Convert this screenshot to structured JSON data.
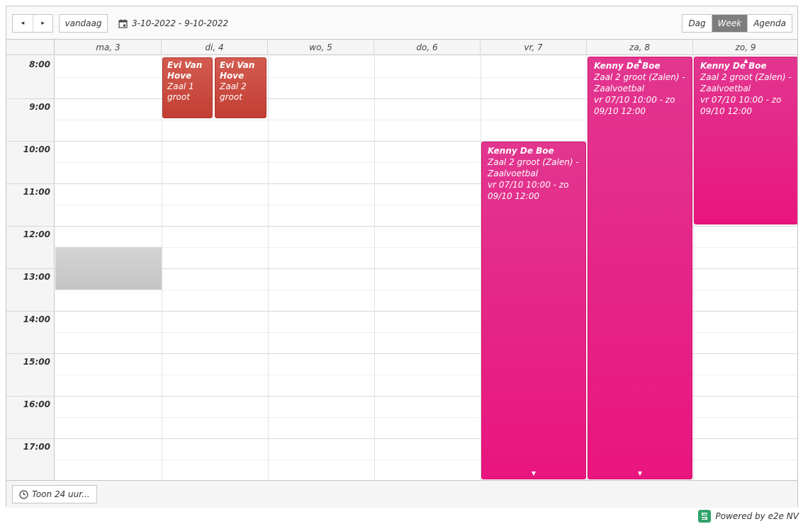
{
  "toolbar": {
    "prev_icon": "◂",
    "next_icon": "▸",
    "today_label": "vandaag",
    "date_range": "3-10-2022 - 9-10-2022",
    "views": [
      "Dag",
      "Week",
      "Agenda"
    ],
    "active_view": "Week"
  },
  "days": [
    "ma, 3",
    "di, 4",
    "wo, 5",
    "do, 6",
    "vr, 7",
    "za, 8",
    "zo, 9"
  ],
  "hours": [
    "8:00",
    "9:00",
    "10:00",
    "11:00",
    "12:00",
    "13:00",
    "14:00",
    "15:00",
    "16:00",
    "17:00"
  ],
  "events": [
    {
      "name": "Evi Van Hove",
      "lines": [
        "Zaal 1 groot"
      ],
      "color": "#c94a3f"
    },
    {
      "name": "Evi Van Hove",
      "lines": [
        "Zaal 2 groot"
      ],
      "color": "#c94a3f"
    },
    {
      "name": "Kenny De Boe",
      "lines": [
        "Zaal 2 groot (Zalen) -",
        "Zaalvoetbal",
        "vr 07/10 10:00 - zo",
        "09/10 12:00"
      ],
      "color": "#e91e80"
    },
    {
      "name": "Kenny De Boe",
      "lines": [
        "Zaal 2 groot (Zalen) -",
        "Zaalvoetbal",
        "vr 07/10 10:00 - zo",
        "09/10 12:00"
      ],
      "color": "#e91e80"
    },
    {
      "name": "Kenny De Boe",
      "lines": [
        "Zaal 2 groot (Zalen) -",
        "Zaalvoetbal",
        "vr 07/10 10:00 - zo",
        "09/10 12:00"
      ],
      "color": "#e91e80"
    }
  ],
  "footer": {
    "toon_label": "Toon 24 uur..."
  },
  "powered_by": "Powered by e2e NV"
}
